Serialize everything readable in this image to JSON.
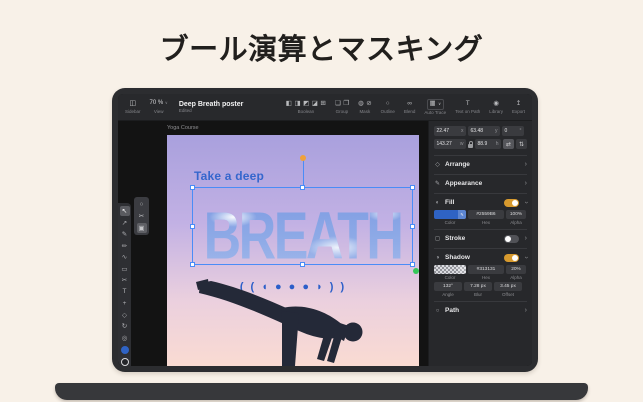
{
  "title": "ブール演算とマスキング",
  "topbar": {
    "sidebar_label": "Sidebar",
    "zoom_value": "70 %",
    "view_label": "View",
    "doc_title": "Deep Breath poster",
    "doc_status": "Edited",
    "boolean_label": "Boolean",
    "group_label": "Group",
    "mask_label": "Mask",
    "outline_label": "Outline",
    "blend_label": "Blend",
    "auto_trace_label": "Auto Trace",
    "text_on_path_label": "Text on Path",
    "library_label": "Library",
    "export_label": "Export"
  },
  "canvas": {
    "artboard_label": "Yoga Course",
    "poster_heading": "Take a deep",
    "poster_word": "BREATH",
    "moon_glyphs": "( ( ◖ ● ● ● ◗ ) )"
  },
  "inspector": {
    "x": "22.47",
    "x_suffix": "x",
    "y": "63.48",
    "y_suffix": "y",
    "rotation": "0",
    "rotation_suffix": "°",
    "width": "143.27",
    "width_suffix": "w",
    "height": "88.9",
    "height_suffix": "h",
    "arrange_label": "Arrange",
    "appearance_label": "Appearance",
    "fill": {
      "label": "Fill",
      "hex": "#2559B6",
      "alpha": "100%",
      "color_label": "Color",
      "hex_label": "Hex",
      "alpha_label": "Alpha"
    },
    "stroke_label": "Stroke",
    "shadow": {
      "label": "Shadow",
      "hex": "#313131",
      "alpha": "20%",
      "color_label": "Color",
      "hex_label": "Hex",
      "alpha_label": "Alpha",
      "angle": "132°",
      "blur": "7.28 px",
      "offset": "3.45 px",
      "angle_label": "Angle",
      "blur_label": "Blur",
      "offset_label": "Offset"
    },
    "path_label": "Path"
  },
  "colors": {
    "accent_toggle": "#D79A2E",
    "selection_blue": "#4A8CF7",
    "fill_swatch": "#2F63C4",
    "moon_blue": "#2B5EC9",
    "poster_text_blue": "#3566CD"
  },
  "icons": {
    "sidebar": "◫",
    "caret": "∨",
    "bool1": "◧",
    "bool2": "◨",
    "bool3": "◩",
    "bool4": "◪",
    "bool5": "⊞",
    "group1": "❏",
    "group2": "❐",
    "mask1": "◍",
    "mask2": "⊘",
    "outline": "○",
    "blend": "∞",
    "auto_trace": "▦",
    "text_on_path": "T",
    "library": "◉",
    "export": "↥",
    "tool_select": "↖",
    "tool_node": "↗",
    "tool_pen": "✎",
    "tool_pencil": "✏",
    "tool_brush": "∿",
    "tool_shape": "▭",
    "tool_scissors": "✂",
    "tool_text": "T",
    "tool_transform": "+",
    "tool_gradient": "◇",
    "tool_rotate": "↻",
    "tool_zoom": "◎",
    "pop_ellipse": "○",
    "pop_scissors": "✂",
    "pop_boolean": "▣",
    "arrange": "◇",
    "appearance": "✎",
    "fill": "◐",
    "stroke": "◻",
    "shadow": "◑",
    "path": "○",
    "dropper": "✎",
    "flip_h": "⇄",
    "flip_v": "⇅",
    "chevron": "›"
  }
}
